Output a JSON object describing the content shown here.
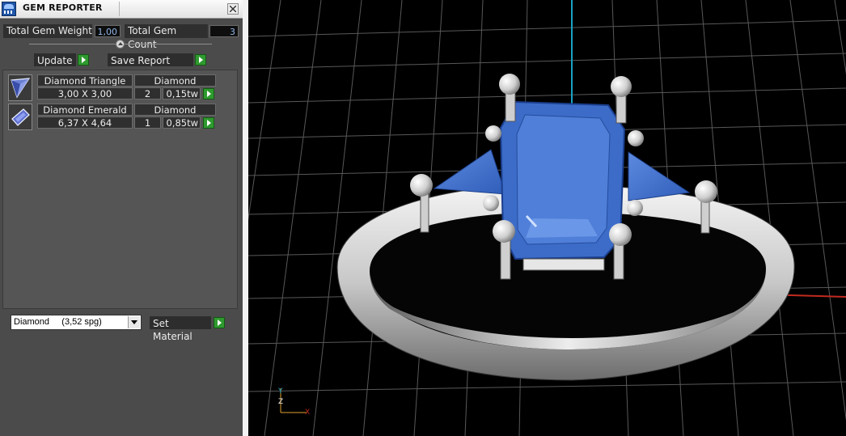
{
  "window": {
    "title": "GEM REPORTER"
  },
  "stats": {
    "total_weight_label": "Total Gem Weight",
    "total_weight_value": "1,00",
    "total_count_label": "Total Gem Count",
    "total_count_value": "3"
  },
  "actions": {
    "update_label": "Update",
    "save_report_label": "Save Report",
    "set_material_label": "Set Material"
  },
  "gems": [
    {
      "name": "Diamond Triangle",
      "material": "Diamond",
      "size": "3,00 X 3,00",
      "count": "2",
      "weight": "0,15tw",
      "icon": "triangle-gem-icon"
    },
    {
      "name": "Diamond Emerald",
      "material": "Diamond",
      "size": "6,37 X 4,64",
      "count": "1",
      "weight": "0,85tw",
      "icon": "emerald-gem-icon"
    }
  ],
  "material_select": {
    "selected": "Diamond     (3,52 spg)"
  },
  "viewport": {
    "axis_labels": {
      "z": "Z",
      "y": "Y",
      "x": "X"
    },
    "colors": {
      "gem": "#3f6fc9",
      "metal": "#d8d8d8",
      "grid": "#5a5a5a",
      "axis_y": "#19a3c4",
      "axis_x": "#c22a1f"
    }
  }
}
